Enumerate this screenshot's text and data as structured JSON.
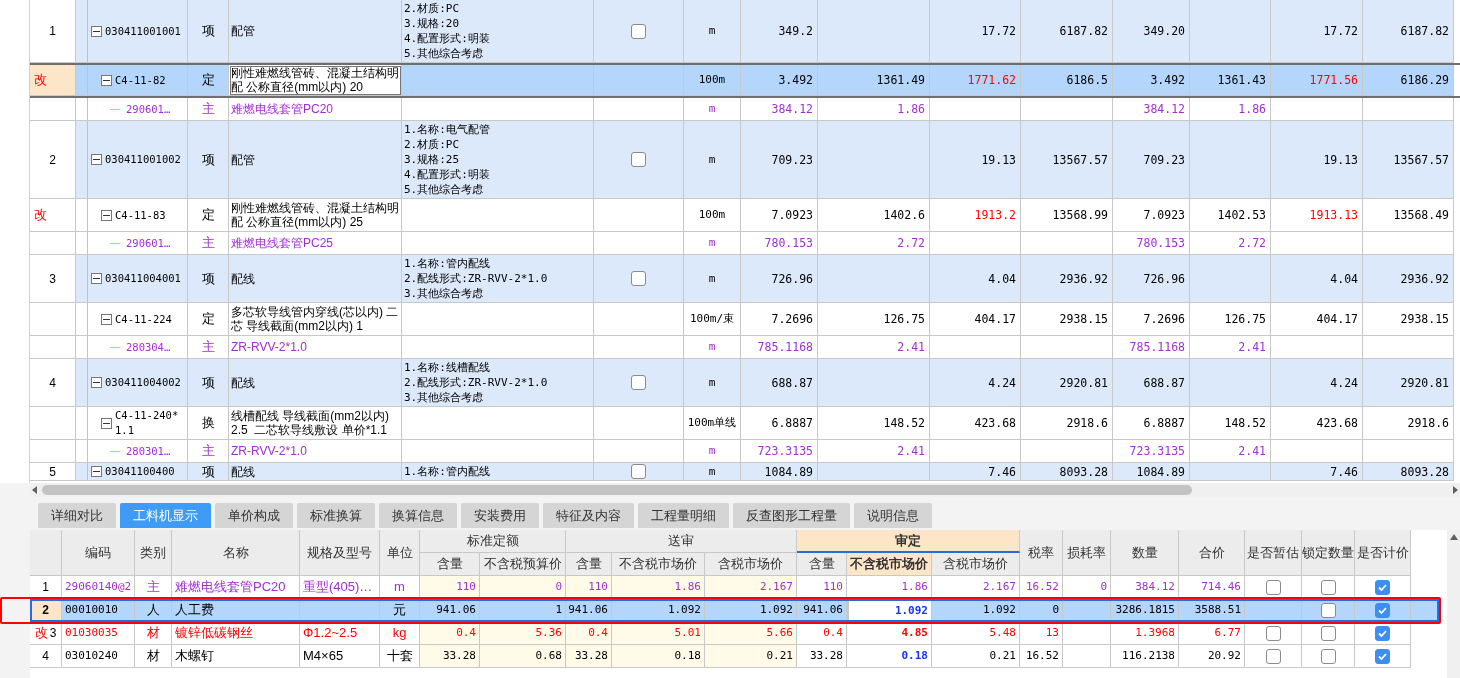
{
  "grid": {
    "rows": [
      {
        "kind": "item",
        "index": "1",
        "code": "030411001001",
        "type": "项",
        "name": "配管",
        "features": [
          "2.材质:PC",
          "3.规格:20",
          "4.配置形式:明装",
          "5.其他综合考虑"
        ],
        "unit": "m",
        "values": {
          "column_1": "349.2",
          "column_3": "17.72",
          "column_4": "6187.82",
          "column_5": "349.20",
          "column_7": "17.72",
          "column_8": "6187.82"
        },
        "expanded": true,
        "checked": false,
        "selected": false
      },
      {
        "kind": "quota",
        "mark": "改",
        "code": "C4-11-82",
        "type": "定",
        "name": "刚性难燃线管砖、混凝土结构明配 公称直径(mm以内) 20",
        "unit": "100m",
        "values": {
          "column_1": {
            "text": "3.492",
            "flagged": false
          },
          "column_2": {
            "text": "1361.49",
            "flagged": false
          },
          "column_3": {
            "text": "1771.62",
            "flagged": true
          },
          "column_4": {
            "text": "6186.5",
            "flagged": false
          },
          "column_5": {
            "text": "3.492",
            "flagged": false
          },
          "column_6": {
            "text": "1361.43",
            "flagged": false
          },
          "column_7": {
            "text": "1771.56",
            "flagged": true
          },
          "column_8": {
            "text": "6186.29",
            "flagged": false
          }
        },
        "expanded": true,
        "selected": true
      },
      {
        "kind": "material",
        "code": "290601…",
        "type": "主",
        "name": "难燃电线套管PC20",
        "unit": "m",
        "values": {
          "column_1": "384.12",
          "column_2": "1.86",
          "column_5": "384.12",
          "column_6": "1.86"
        },
        "selected": false
      },
      {
        "kind": "item",
        "index": "2",
        "code": "030411001002",
        "type": "项",
        "name": "配管",
        "features": [
          "1.名称:电气配管",
          "2.材质:PC",
          "3.规格:25",
          "4.配置形式:明装",
          "5.其他综合考虑"
        ],
        "unit": "m",
        "values": {
          "column_1": "709.23",
          "column_3": "19.13",
          "column_4": "13567.57",
          "column_5": "709.23",
          "column_7": "19.13",
          "column_8": "13567.57"
        },
        "expanded": true,
        "checked": false,
        "selected": false
      },
      {
        "kind": "quota",
        "mark": "改",
        "code": "C4-11-83",
        "type": "定",
        "name": "刚性难燃线管砖、混凝土结构明配 公称直径(mm以内) 25",
        "unit": "100m",
        "values": {
          "column_1": {
            "text": "7.0923",
            "flagged": false
          },
          "column_2": {
            "text": "1402.6",
            "flagged": false
          },
          "column_3": {
            "text": "1913.2",
            "flagged": true
          },
          "column_4": {
            "text": "13568.99",
            "flagged": false
          },
          "column_5": {
            "text": "7.0923",
            "flagged": false
          },
          "column_6": {
            "text": "1402.53",
            "flagged": false
          },
          "column_7": {
            "text": "1913.13",
            "flagged": true
          },
          "column_8": {
            "text": "13568.49",
            "flagged": false
          }
        },
        "expanded": true,
        "selected": false
      },
      {
        "kind": "material",
        "code": "290601…",
        "type": "主",
        "name": "难燃电线套管PC25",
        "unit": "m",
        "values": {
          "column_1": "780.153",
          "column_2": "2.72",
          "column_5": "780.153",
          "column_6": "2.72"
        },
        "selected": false
      },
      {
        "kind": "item",
        "index": "3",
        "code": "030411004001",
        "type": "项",
        "name": "配线",
        "features": [
          "1.名称:管内配线",
          "2.配线形式:ZR-RVV-2*1.0",
          "3.其他综合考虑"
        ],
        "unit": "m",
        "values": {
          "column_1": "726.96",
          "column_3": "4.04",
          "column_4": "2936.92",
          "column_5": "726.96",
          "column_7": "4.04",
          "column_8": "2936.92"
        },
        "expanded": true,
        "checked": false,
        "selected": false
      },
      {
        "kind": "quota",
        "code": "C4-11-224",
        "type": "定",
        "name": "多芯软导线管内穿线(芯以内) 二芯 导线截面(mm2以内) 1",
        "unit": "100m/束",
        "values": {
          "column_1": {
            "text": "7.2696",
            "flagged": false
          },
          "column_2": {
            "text": "126.75",
            "flagged": false
          },
          "column_3": {
            "text": "404.17",
            "flagged": false
          },
          "column_4": {
            "text": "2938.15",
            "flagged": false
          },
          "column_5": {
            "text": "7.2696",
            "flagged": false
          },
          "column_6": {
            "text": "126.75",
            "flagged": false
          },
          "column_7": {
            "text": "404.17",
            "flagged": false
          },
          "column_8": {
            "text": "2938.15",
            "flagged": false
          }
        },
        "expanded": true,
        "selected": false
      },
      {
        "kind": "material",
        "code": "280304…",
        "type": "主",
        "name": "ZR-RVV-2*1.0",
        "unit": "m",
        "values": {
          "column_1": "785.1168",
          "column_2": "2.41",
          "column_5": "785.1168",
          "column_6": "2.41"
        },
        "selected": false
      },
      {
        "kind": "item",
        "index": "4",
        "code": "030411004002",
        "type": "项",
        "name": "配线",
        "features": [
          "1.名称:线槽配线",
          "2.配线形式:ZR-RVV-2*1.0",
          "3.其他综合考虑"
        ],
        "unit": "m",
        "values": {
          "column_1": "688.87",
          "column_3": "4.24",
          "column_4": "2920.81",
          "column_5": "688.87",
          "column_7": "4.24",
          "column_8": "2920.81"
        },
        "expanded": true,
        "checked": false,
        "selected": false
      },
      {
        "kind": "quota",
        "code": "C4-11-240*1.1",
        "type": "换",
        "name": "线槽配线 导线截面(mm2以内) 2.5  二芯软导线敷设 单价*1.1",
        "unit": "100m单线",
        "values": {
          "column_1": {
            "text": "6.8887",
            "flagged": false
          },
          "column_2": {
            "text": "148.52",
            "flagged": false
          },
          "column_3": {
            "text": "423.68",
            "flagged": false
          },
          "column_4": {
            "text": "2918.6",
            "flagged": false
          },
          "column_5": {
            "text": "6.8887",
            "flagged": false
          },
          "column_6": {
            "text": "148.52",
            "flagged": false
          },
          "column_7": {
            "text": "423.68",
            "flagged": false
          },
          "column_8": {
            "text": "2918.6",
            "flagged": false
          }
        },
        "expanded": true,
        "selected": false
      },
      {
        "kind": "material",
        "code": "280301…",
        "type": "主",
        "name": "ZR-RVV-2*1.0",
        "unit": "m",
        "values": {
          "column_1": "723.3135",
          "column_2": "2.41",
          "column_5": "723.3135",
          "column_6": "2.41"
        },
        "selected": false
      },
      {
        "kind": "item",
        "index": "5",
        "code": "03041100400",
        "type": "项",
        "name": "配线",
        "features": [
          "1.名称:管内配线"
        ],
        "unit": "m",
        "values": {
          "column_1": "1084.89",
          "column_3": "7.46",
          "column_4": "8093.28",
          "column_5": "1084.89",
          "column_7": "7.46",
          "column_8": "8093.28"
        },
        "expanded": true,
        "checked": false,
        "selected": false
      }
    ]
  },
  "tabs": [
    {
      "label": "详细对比",
      "selected": false
    },
    {
      "label": "工料机显示",
      "selected": true
    },
    {
      "label": "单价构成",
      "selected": false
    },
    {
      "label": "标准换算",
      "selected": false
    },
    {
      "label": "换算信息",
      "selected": false
    },
    {
      "label": "安装费用",
      "selected": false
    },
    {
      "label": "特征及内容",
      "selected": false
    },
    {
      "label": "工程量明细",
      "selected": false
    },
    {
      "label": "反查图形工程量",
      "selected": false
    },
    {
      "label": "说明信息",
      "selected": false
    }
  ],
  "resources": {
    "column_groups": [
      {
        "label": "标准定额",
        "selected": false
      },
      {
        "label": "送审",
        "selected": false
      },
      {
        "label": "审定",
        "selected": true
      }
    ],
    "columns": [
      {
        "label": "编码",
        "selected": false
      },
      {
        "label": "类别",
        "selected": false
      },
      {
        "label": "名称",
        "selected": false
      },
      {
        "label": "规格及型号",
        "selected": false
      },
      {
        "label": "单位",
        "selected": false
      },
      {
        "label": "含量",
        "selected": false
      },
      {
        "label": "不含税预算价",
        "selected": false
      },
      {
        "label": "含量",
        "selected": false
      },
      {
        "label": "不含税市场价",
        "selected": false
      },
      {
        "label": "含税市场价",
        "selected": false
      },
      {
        "label": "含量",
        "selected": false
      },
      {
        "label": "不含税市场价",
        "selected": true
      },
      {
        "label": "含税市场价",
        "selected": false
      },
      {
        "label": "税率",
        "selected": false
      },
      {
        "label": "损耗率",
        "selected": false
      },
      {
        "label": "数量",
        "selected": false
      },
      {
        "label": "合价",
        "selected": false
      },
      {
        "label": "是否暂估",
        "selected": false
      },
      {
        "label": "锁定数量",
        "selected": false
      },
      {
        "label": "是否计价",
        "selected": false
      }
    ],
    "rows": [
      {
        "index": "1",
        "kind": "main",
        "modified": false,
        "selected": false,
        "cells": [
          "29060140@2",
          "主",
          "难燃电线套管PC20",
          "重型(405)…",
          "m",
          "110",
          "0",
          "110",
          "1.86",
          "2.167",
          "110",
          "1.86",
          "2.167",
          "16.52",
          "0",
          "384.12",
          "714.46"
        ],
        "provisional": false,
        "lock_qty": false,
        "priced": true
      },
      {
        "index": "2",
        "kind": "labor",
        "modified": false,
        "selected": true,
        "cells": [
          "00010010",
          "人",
          "人工费",
          "",
          "元",
          "941.06",
          "1",
          "941.06",
          "1.092",
          "1.092",
          "941.06",
          "1.092",
          "1.092",
          "0",
          "",
          "3286.1815",
          "3588.51"
        ],
        "lock_qty": false,
        "priced": true
      },
      {
        "index": "3",
        "mark": "改",
        "kind": "material",
        "modified": true,
        "selected": false,
        "cells": [
          "01030035",
          "材",
          "镀锌低碳钢丝",
          "Φ1.2~2.5",
          "kg",
          "0.4",
          "5.36",
          "0.4",
          "5.01",
          "5.66",
          "0.4",
          "4.85",
          "5.48",
          "13",
          "",
          "1.3968",
          "6.77"
        ],
        "provisional": false,
        "lock_qty": false,
        "priced": true
      },
      {
        "index": "4",
        "kind": "material",
        "modified": false,
        "selected": false,
        "cells": [
          "03010240",
          "材",
          "木螺钉",
          "M4×65",
          "十套",
          "33.28",
          "0.68",
          "33.28",
          "0.18",
          "0.21",
          "33.28",
          "0.18",
          "0.21",
          "16.52",
          "",
          "116.2138",
          "20.92"
        ],
        "provisional": false,
        "lock_qty": false,
        "priced": true
      }
    ]
  }
}
